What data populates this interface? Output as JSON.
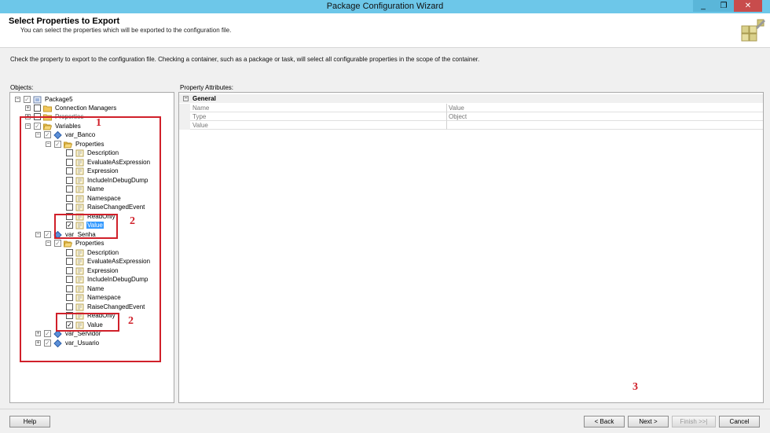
{
  "window": {
    "title": "Package Configuration Wizard",
    "controls": {
      "minimize": "_",
      "restore": "❐",
      "close": "✕"
    }
  },
  "header": {
    "title": "Select Properties to Export",
    "subtitle": "You can select the properties which will be exported to the configuration file."
  },
  "instruction": "Check the property to export to the configuration file. Checking a container, such as a package or task, will select all configurable properties in the scope of the container.",
  "objects_label": "Objects:",
  "property_attributes_label": "Property Attributes:",
  "tree": {
    "package": "Package5",
    "connection_managers": "Connection Managers",
    "properties_root": "Properties",
    "variables": "Variables",
    "var_banco": "var_Banco",
    "var_senha": "var_Senha",
    "var_servidor": "var_Servidor",
    "var_usuario": "var_Usuario",
    "properties": "Properties",
    "description": "Description",
    "evaluate_as_expression": "EvaluateAsExpression",
    "expression": "Expression",
    "include_in_debug_dump": "IncludeInDebugDump",
    "name": "Name",
    "namespace": "Namespace",
    "raise_changed_event": "RaiseChangedEvent",
    "read_only": "ReadOnly",
    "value": "Value"
  },
  "property_attributes": {
    "group": "General",
    "rows": [
      {
        "key": "Name",
        "value": "Value"
      },
      {
        "key": "Type",
        "value": "Object"
      },
      {
        "key": "Value",
        "value": ""
      }
    ]
  },
  "annotations": {
    "a1": "1",
    "a2": "2",
    "a3": "2",
    "a4": "3"
  },
  "buttons": {
    "help": "Help",
    "back": "< Back",
    "next": "Next >",
    "finish": "Finish >>|",
    "cancel": "Cancel"
  },
  "colors": {
    "titlebar": "#6dc7e9",
    "annotation": "#d0202a",
    "selection": "#3399ff"
  }
}
